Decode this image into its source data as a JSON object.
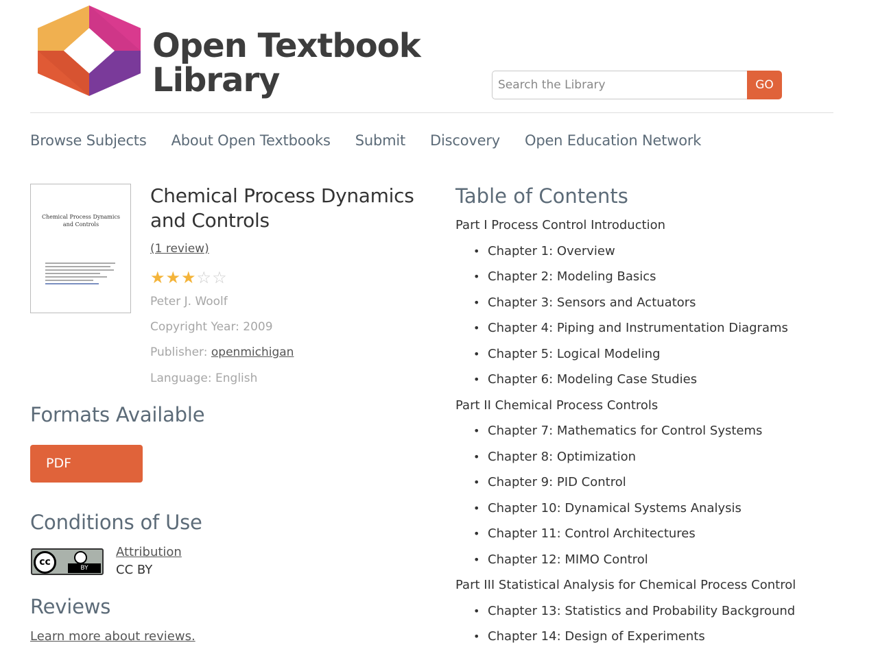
{
  "site": {
    "logo_line1": "Open Textbook",
    "logo_line2": "Library",
    "search_placeholder": "Search the Library",
    "search_button": "GO"
  },
  "nav": [
    "Browse Subjects",
    "About Open Textbooks",
    "Submit",
    "Discovery",
    "Open Education Network"
  ],
  "book": {
    "cover_title": "Chemical Process Dynamics and Controls",
    "title": "Chemical Process Dynamics and Controls",
    "reviews_link": "(1 review)",
    "rating": 3,
    "rating_max": 5,
    "author": "Peter J. Woolf",
    "copyright": "Copyright Year: 2009",
    "publisher_label": "Publisher:",
    "publisher": "openmichigan",
    "language": "Language: English"
  },
  "formats": {
    "heading": "Formats Available",
    "pdf": "PDF"
  },
  "conditions": {
    "heading": "Conditions of Use",
    "license_link": "Attribution",
    "license": "CC BY",
    "badge_text": "BY",
    "cc_symbol": "cc"
  },
  "reviews": {
    "heading": "Reviews",
    "learn_more": "Learn more about reviews."
  },
  "toc": {
    "heading": "Table of Contents",
    "items": [
      {
        "type": "part",
        "text": "Part I Process Control Introduction"
      },
      {
        "type": "chapter",
        "text": "Chapter 1: Overview"
      },
      {
        "type": "chapter",
        "text": "Chapter 2: Modeling Basics"
      },
      {
        "type": "chapter",
        "text": "Chapter 3: Sensors and Actuators"
      },
      {
        "type": "chapter",
        "text": "Chapter 4: Piping and Instrumentation Diagrams"
      },
      {
        "type": "chapter",
        "text": "Chapter 5: Logical Modeling"
      },
      {
        "type": "chapter",
        "text": "Chapter 6: Modeling Case Studies"
      },
      {
        "type": "part",
        "text": "Part II Chemical Process Controls"
      },
      {
        "type": "chapter",
        "text": "Chapter 7: Mathematics for Control Systems"
      },
      {
        "type": "chapter",
        "text": "Chapter 8: Optimization"
      },
      {
        "type": "chapter",
        "text": "Chapter 9: PID Control"
      },
      {
        "type": "chapter",
        "text": "Chapter 10: Dynamical Systems Analysis"
      },
      {
        "type": "chapter",
        "text": "Chapter 11: Control Architectures"
      },
      {
        "type": "chapter",
        "text": "Chapter 12: MIMO Control"
      },
      {
        "type": "part",
        "text": "Part III Statistical Analysis for Chemical Process Control"
      },
      {
        "type": "chapter",
        "text": "Chapter 13: Statistics and Probability Background"
      },
      {
        "type": "chapter",
        "text": "Chapter 14: Design of Experiments"
      }
    ]
  },
  "colors": {
    "accent": "#e0633a",
    "nav_text": "#5c6b78",
    "star_filled": "#f4b43a",
    "star_empty": "#cccccc"
  }
}
